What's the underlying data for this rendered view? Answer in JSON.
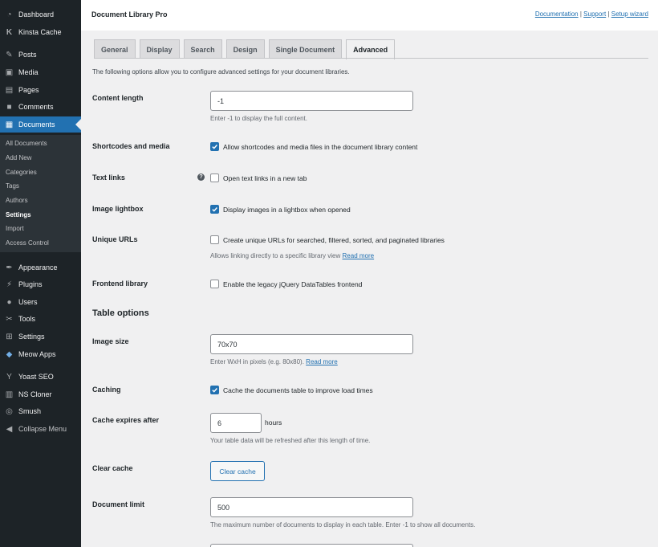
{
  "sidebar": {
    "items": [
      {
        "label": "Dashboard",
        "icon": "dashboard-icon"
      },
      {
        "label": "Kinsta Cache",
        "icon": "kinsta-icon"
      },
      {
        "label": "Posts",
        "icon": "pin-icon"
      },
      {
        "label": "Media",
        "icon": "media-icon"
      },
      {
        "label": "Pages",
        "icon": "pages-icon"
      },
      {
        "label": "Comments",
        "icon": "comments-icon"
      },
      {
        "label": "Documents",
        "icon": "documents-icon"
      },
      {
        "label": "Appearance",
        "icon": "appearance-icon"
      },
      {
        "label": "Plugins",
        "icon": "plugins-icon"
      },
      {
        "label": "Users",
        "icon": "users-icon"
      },
      {
        "label": "Tools",
        "icon": "tools-icon"
      },
      {
        "label": "Settings",
        "icon": "settings-icon"
      },
      {
        "label": "Meow Apps",
        "icon": "meow-icon"
      },
      {
        "label": "Yoast SEO",
        "icon": "yoast-icon"
      },
      {
        "label": "NS Cloner",
        "icon": "cloner-icon"
      },
      {
        "label": "Smush",
        "icon": "smush-icon"
      },
      {
        "label": "Collapse Menu",
        "icon": "collapse-icon"
      }
    ],
    "submenu": [
      "All Documents",
      "Add New",
      "Categories",
      "Tags",
      "Authors",
      "Settings",
      "Import",
      "Access Control"
    ]
  },
  "header": {
    "title": "Document Library Pro",
    "links": [
      "Documentation",
      "Support",
      "Setup wizard"
    ],
    "separator": "|"
  },
  "tabs": [
    "General",
    "Display",
    "Search",
    "Design",
    "Single Document",
    "Advanced"
  ],
  "intro": "The following options allow you to configure advanced settings for your document libraries.",
  "fields": {
    "content_length": {
      "label": "Content length",
      "value": "-1",
      "desc": "Enter -1 to display the full content."
    },
    "shortcodes": {
      "label": "Shortcodes and media",
      "text": "Allow shortcodes and media files in the document library content",
      "checked": true
    },
    "text_links": {
      "label": "Text links",
      "text": "Open text links in a new tab",
      "checked": false,
      "help": "?"
    },
    "lightbox": {
      "label": "Image lightbox",
      "text": "Display images in a lightbox when opened",
      "checked": true
    },
    "unique_urls": {
      "label": "Unique URLs",
      "text": "Create unique URLs for searched, filtered, sorted, and paginated libraries",
      "checked": false,
      "desc": "Allows linking directly to a specific library view",
      "link": "Read more"
    },
    "frontend": {
      "label": "Frontend library",
      "text": "Enable the legacy jQuery DataTables frontend",
      "checked": false
    }
  },
  "table_options": {
    "title": "Table options",
    "image_size": {
      "label": "Image size",
      "value": "70x70",
      "desc": "Enter WxH in pixels (e.g. 80x80).",
      "link": "Read more"
    },
    "caching": {
      "label": "Caching",
      "text": "Cache the documents table to improve load times",
      "checked": true
    },
    "cache_expires": {
      "label": "Cache expires after",
      "value": "6",
      "unit": "hours",
      "desc": "Your table data will be refreshed after this length of time."
    },
    "clear_cache": {
      "label": "Clear cache",
      "button": "Clear cache"
    },
    "doc_limit": {
      "label": "Document limit",
      "value": "500",
      "desc": "The maximum number of documents to display in each table. Enter -1 to show all documents."
    }
  },
  "colors": {
    "accent": "#2271b1",
    "sidebar": "#1d2327"
  }
}
